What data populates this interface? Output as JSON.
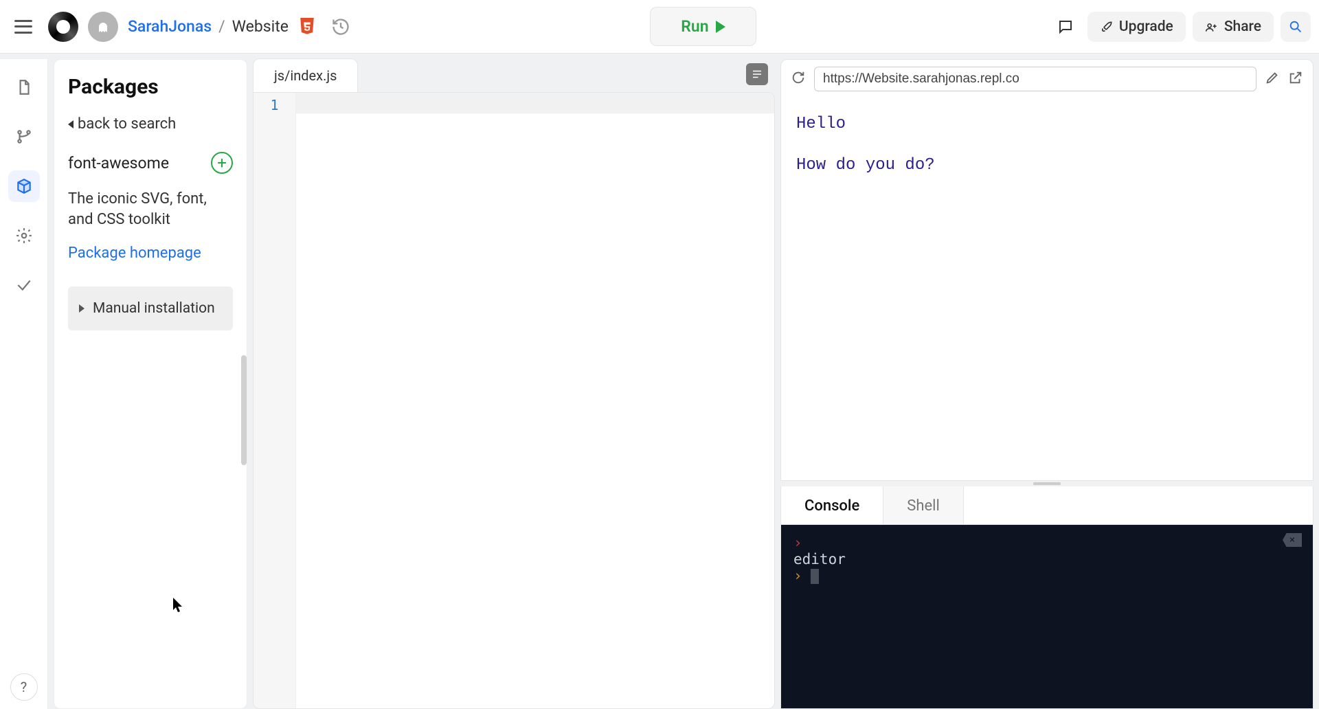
{
  "header": {
    "user": "SarahJonas",
    "separator": "/",
    "project": "Website",
    "run_label": "Run",
    "upgrade_label": "Upgrade",
    "share_label": "Share"
  },
  "sidebar": {
    "title": "Packages",
    "back_label": "back to search",
    "package_name": "font-awesome",
    "package_desc": "The iconic SVG, font, and CSS toolkit",
    "homepage_label": "Package homepage",
    "manual_label": "Manual installation"
  },
  "editor": {
    "tab": "js/index.js",
    "line_number": "1"
  },
  "preview": {
    "url": "https://Website.sarahjonas.repl.co",
    "lines": [
      "Hello",
      "How do you do?"
    ]
  },
  "console": {
    "tabs": [
      "Console",
      "Shell"
    ],
    "output": "editor"
  }
}
